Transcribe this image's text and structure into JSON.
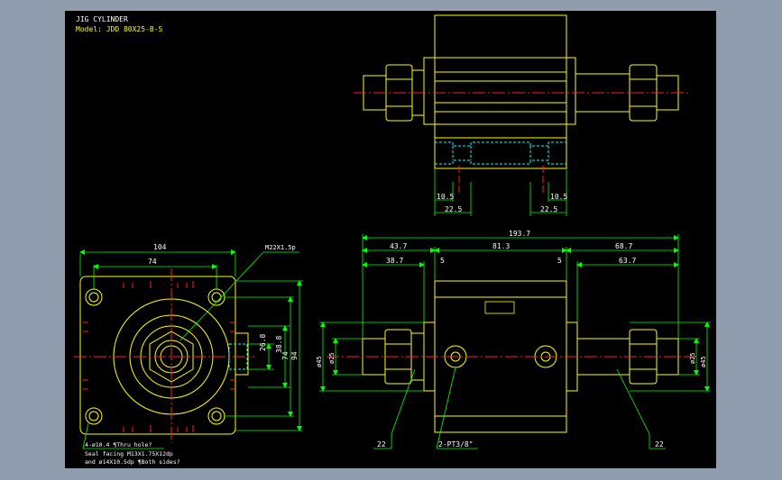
{
  "title_block": {
    "title": "JIG CYLINDER",
    "model": "Model: JDD 80X25-B-S"
  },
  "colors": {
    "background": "#000000",
    "frame": "#8f9dae",
    "outline": "#ffff00",
    "dimension": "#00ff00",
    "centerline": "#ff2020",
    "hidden": "#00ffff",
    "leader": "#00ff00",
    "text": "#ffffff"
  },
  "top_view": {
    "dims": {
      "left_small": "10.5",
      "left_large": "22.5",
      "right_small": "10.5",
      "right_large": "22.5"
    }
  },
  "side_view": {
    "dims": {
      "width": "104",
      "hole_span": "74",
      "port_small": "26.8",
      "port_large": "38.8",
      "span_inner": "74",
      "height": "94"
    },
    "notes": {
      "thread": "M22X1.5p",
      "holes_1": "4-ø10.4 ¶Thru hole?",
      "holes_2": "Seal facing  M13X1.75X12dp",
      "holes_3": "and ø14X10.5dp ¶Both sides?"
    }
  },
  "front_view": {
    "dims": {
      "overall": "193.7",
      "seg_left": "43.7",
      "seg_mid": "81.3",
      "seg_right": "68.7",
      "sub_left": "38.7",
      "gap_left": "5",
      "gap_right": "5",
      "sub_right": "63.7",
      "dia_left_1": "ø25",
      "dia_left_2": "ø45",
      "dia_right_1": "ø25",
      "dia_right_2": "ø45",
      "wrench_left": "22",
      "wrench_right": "22",
      "port": "2-PT3/8\""
    }
  }
}
